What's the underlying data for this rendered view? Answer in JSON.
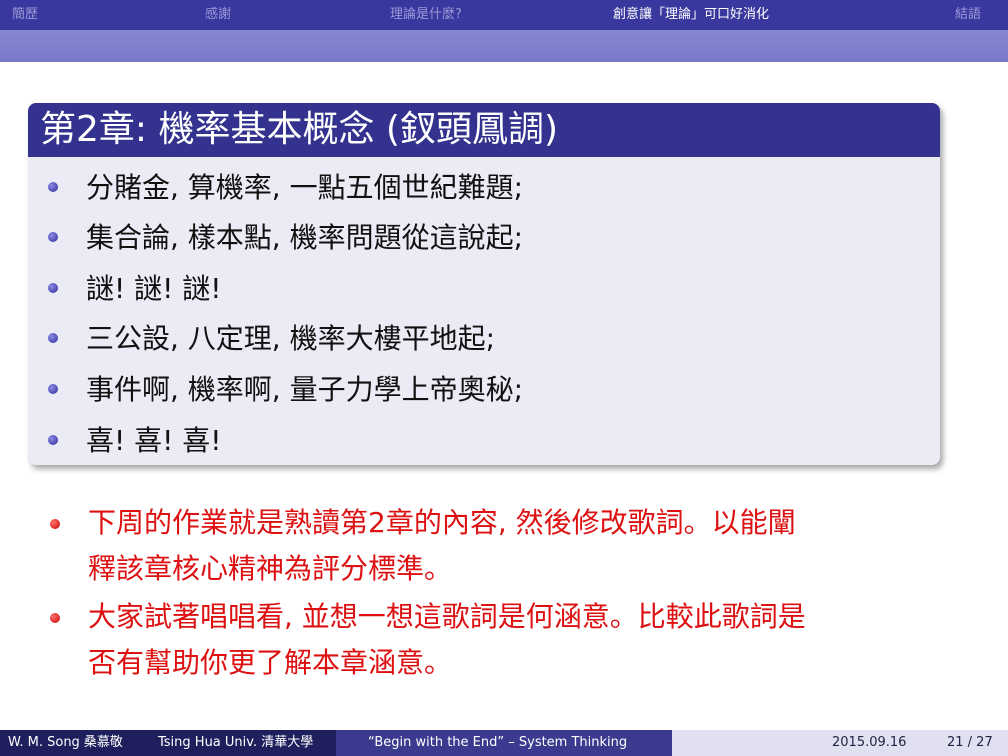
{
  "nav": {
    "items": [
      "簡歷",
      "感謝",
      "理論是什麼?",
      "創意讓「理論」可口好消化",
      "結語"
    ],
    "active_index": 3
  },
  "block": {
    "title": "第2章: 機率基本概念 (釵頭鳳調)",
    "items": [
      "分賭金, 算機率, 一點五個世紀難題;",
      "集合論, 樣本點, 機率問題從這說起;",
      "謎! 謎! 謎!",
      "三公設, 八定理, 機率大樓平地起;",
      "事件啊, 機率啊, 量子力學上帝奧秘;",
      "喜! 喜! 喜!"
    ]
  },
  "notes": [
    {
      "line1": "下周的作業就是熟讀第2章的內容, 然後修改歌詞。以能闡",
      "line2": "釋該章核心精神為評分標準。"
    },
    {
      "line1": "大家試著唱唱看, 並想一想這歌詞是何涵意。比較此歌詞是",
      "line2": "否有幫助你更了解本章涵意。"
    }
  ],
  "footer": {
    "author": "W. M. Song 桑慕敬",
    "institute": "Tsing Hua Univ. 清華大學",
    "talk_title": "“Begin with the End” – System Thinking",
    "date": "2015.09.16",
    "page": "21 / 27"
  },
  "colors": {
    "nav_bg": "#38389e",
    "nav_sub_bg": "#7e7ece",
    "block_title_bg": "#33338f",
    "block_body_bg": "#ebebf6",
    "note_text": "#dd1111"
  }
}
